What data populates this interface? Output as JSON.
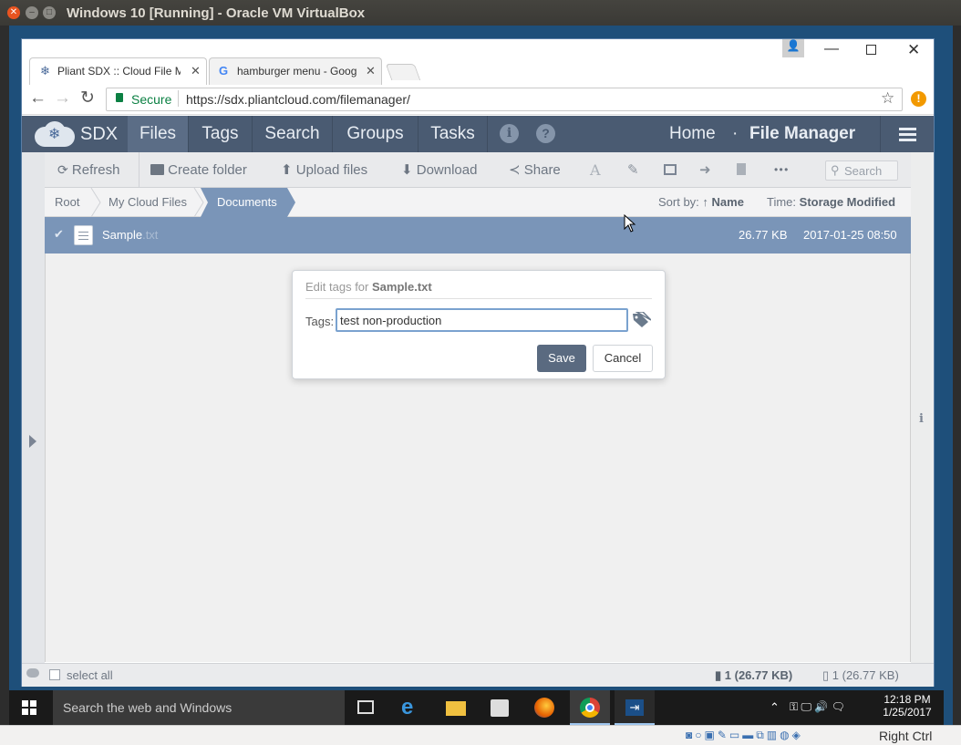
{
  "host": {
    "title": "Windows 10 [Running] - Oracle VM VirtualBox",
    "host_key_label": "Right Ctrl"
  },
  "browser": {
    "tabs": [
      {
        "label": "Pliant SDX :: Cloud File M",
        "active": true
      },
      {
        "label": "hamburger menu - Goog",
        "active": false
      }
    ],
    "secure_label": "Secure",
    "url": "https://sdx.pliantcloud.com/filemanager/"
  },
  "app": {
    "logo_text": "SDX",
    "nav": [
      "Files",
      "Tags",
      "Search",
      "Groups",
      "Tasks"
    ],
    "header_right": {
      "home": "Home",
      "separator": "·",
      "page": "File Manager"
    },
    "toolbar": {
      "refresh": "Refresh",
      "create_folder": "Create folder",
      "upload": "Upload files",
      "download": "Download",
      "share": "Share",
      "more": "• • •",
      "search_placeholder": "Search"
    },
    "breadcrumbs": [
      "Root",
      "My Cloud Files",
      "Documents"
    ],
    "sort": {
      "label": "Sort by:",
      "arrow": "↑",
      "value": "Name"
    },
    "time": {
      "label": "Time:",
      "value": "Storage Modified"
    },
    "file": {
      "name": "Sample",
      "ext": ".txt",
      "size": "26.77 KB",
      "date": "2017-01-25 08:50"
    },
    "dialog": {
      "title_prefix": "Edit tags for",
      "title_file": "Sample.txt",
      "tags_label": "Tags:",
      "tags_value": "test non-production",
      "save": "Save",
      "cancel": "Cancel"
    },
    "status": {
      "select_all": "select all",
      "selected": "1 (26.77 KB)",
      "total": "1 (26.77 KB)"
    }
  },
  "taskbar": {
    "search_placeholder": "Search the web and Windows",
    "time": "12:18 PM",
    "date": "1/25/2017"
  },
  "colors": {
    "header_bg": "#4a5b72",
    "selected_row": "#7a95b8",
    "save_button": "#5a6a80"
  }
}
